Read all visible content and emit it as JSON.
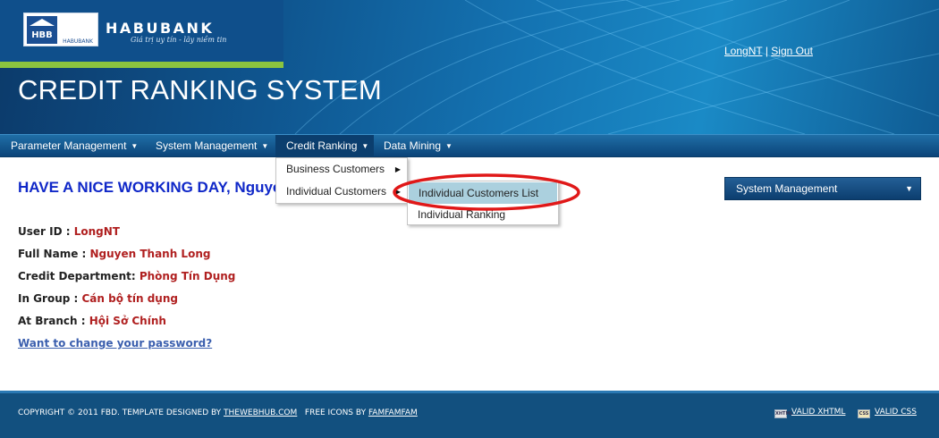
{
  "brand": {
    "logo_mark": "HBB",
    "logo_sub": "HABUBANK",
    "name": "HABUBANK",
    "slogan": "Giá trị uy tín - lãy niềm tin"
  },
  "header": {
    "system_title": "CREDIT RANKING SYSTEM",
    "user_link": "LongNT",
    "separator": " | ",
    "signout_link": "Sign Out"
  },
  "menu": {
    "items": [
      {
        "label": "Parameter Management"
      },
      {
        "label": "System Management"
      },
      {
        "label": "Credit Ranking"
      },
      {
        "label": "Data Mining"
      }
    ],
    "credit_ranking_submenu": [
      {
        "label": "Business Customers"
      },
      {
        "label": "Individual Customers"
      }
    ],
    "individual_submenu": [
      {
        "label": "Individual Customers List"
      },
      {
        "label": "Individual Ranking"
      }
    ]
  },
  "main": {
    "welcome": "HAVE A NICE WORKING DAY, Nguyen Thanh Long",
    "fields": [
      {
        "label": "User ID : ",
        "value": "LongNT"
      },
      {
        "label": "Full Name : ",
        "value": "Nguyen Thanh Long"
      },
      {
        "label": "Credit Department: ",
        "value": "Phòng Tín Dụng"
      },
      {
        "label": "In Group : ",
        "value": "Cán bộ tín dụng"
      },
      {
        "label": "At Branch : ",
        "value": "Hội Sở Chính"
      }
    ],
    "change_password": "Want to change your password?",
    "system_select": "System Management"
  },
  "footer": {
    "copyright": "COPYRIGHT © 2011 FBD. TEMPLATE DESIGNED BY ",
    "webhub_link": "THEWEBHUB.COM",
    "icons_text": "FREE ICONS BY ",
    "famfam_link": "FAMFAMFAM",
    "valid_xhtml": "VALID XHTML",
    "valid_css": "VALID CSS",
    "xhtml_badge": "XHTML",
    "css_badge": "CSS"
  },
  "colors": {
    "header_blue": "#0f5690",
    "accent_green": "#8bc43f",
    "welcome_blue": "#1028c8",
    "value_red": "#b02020",
    "highlight": "#abd0de",
    "annotation_red": "#e01818"
  }
}
